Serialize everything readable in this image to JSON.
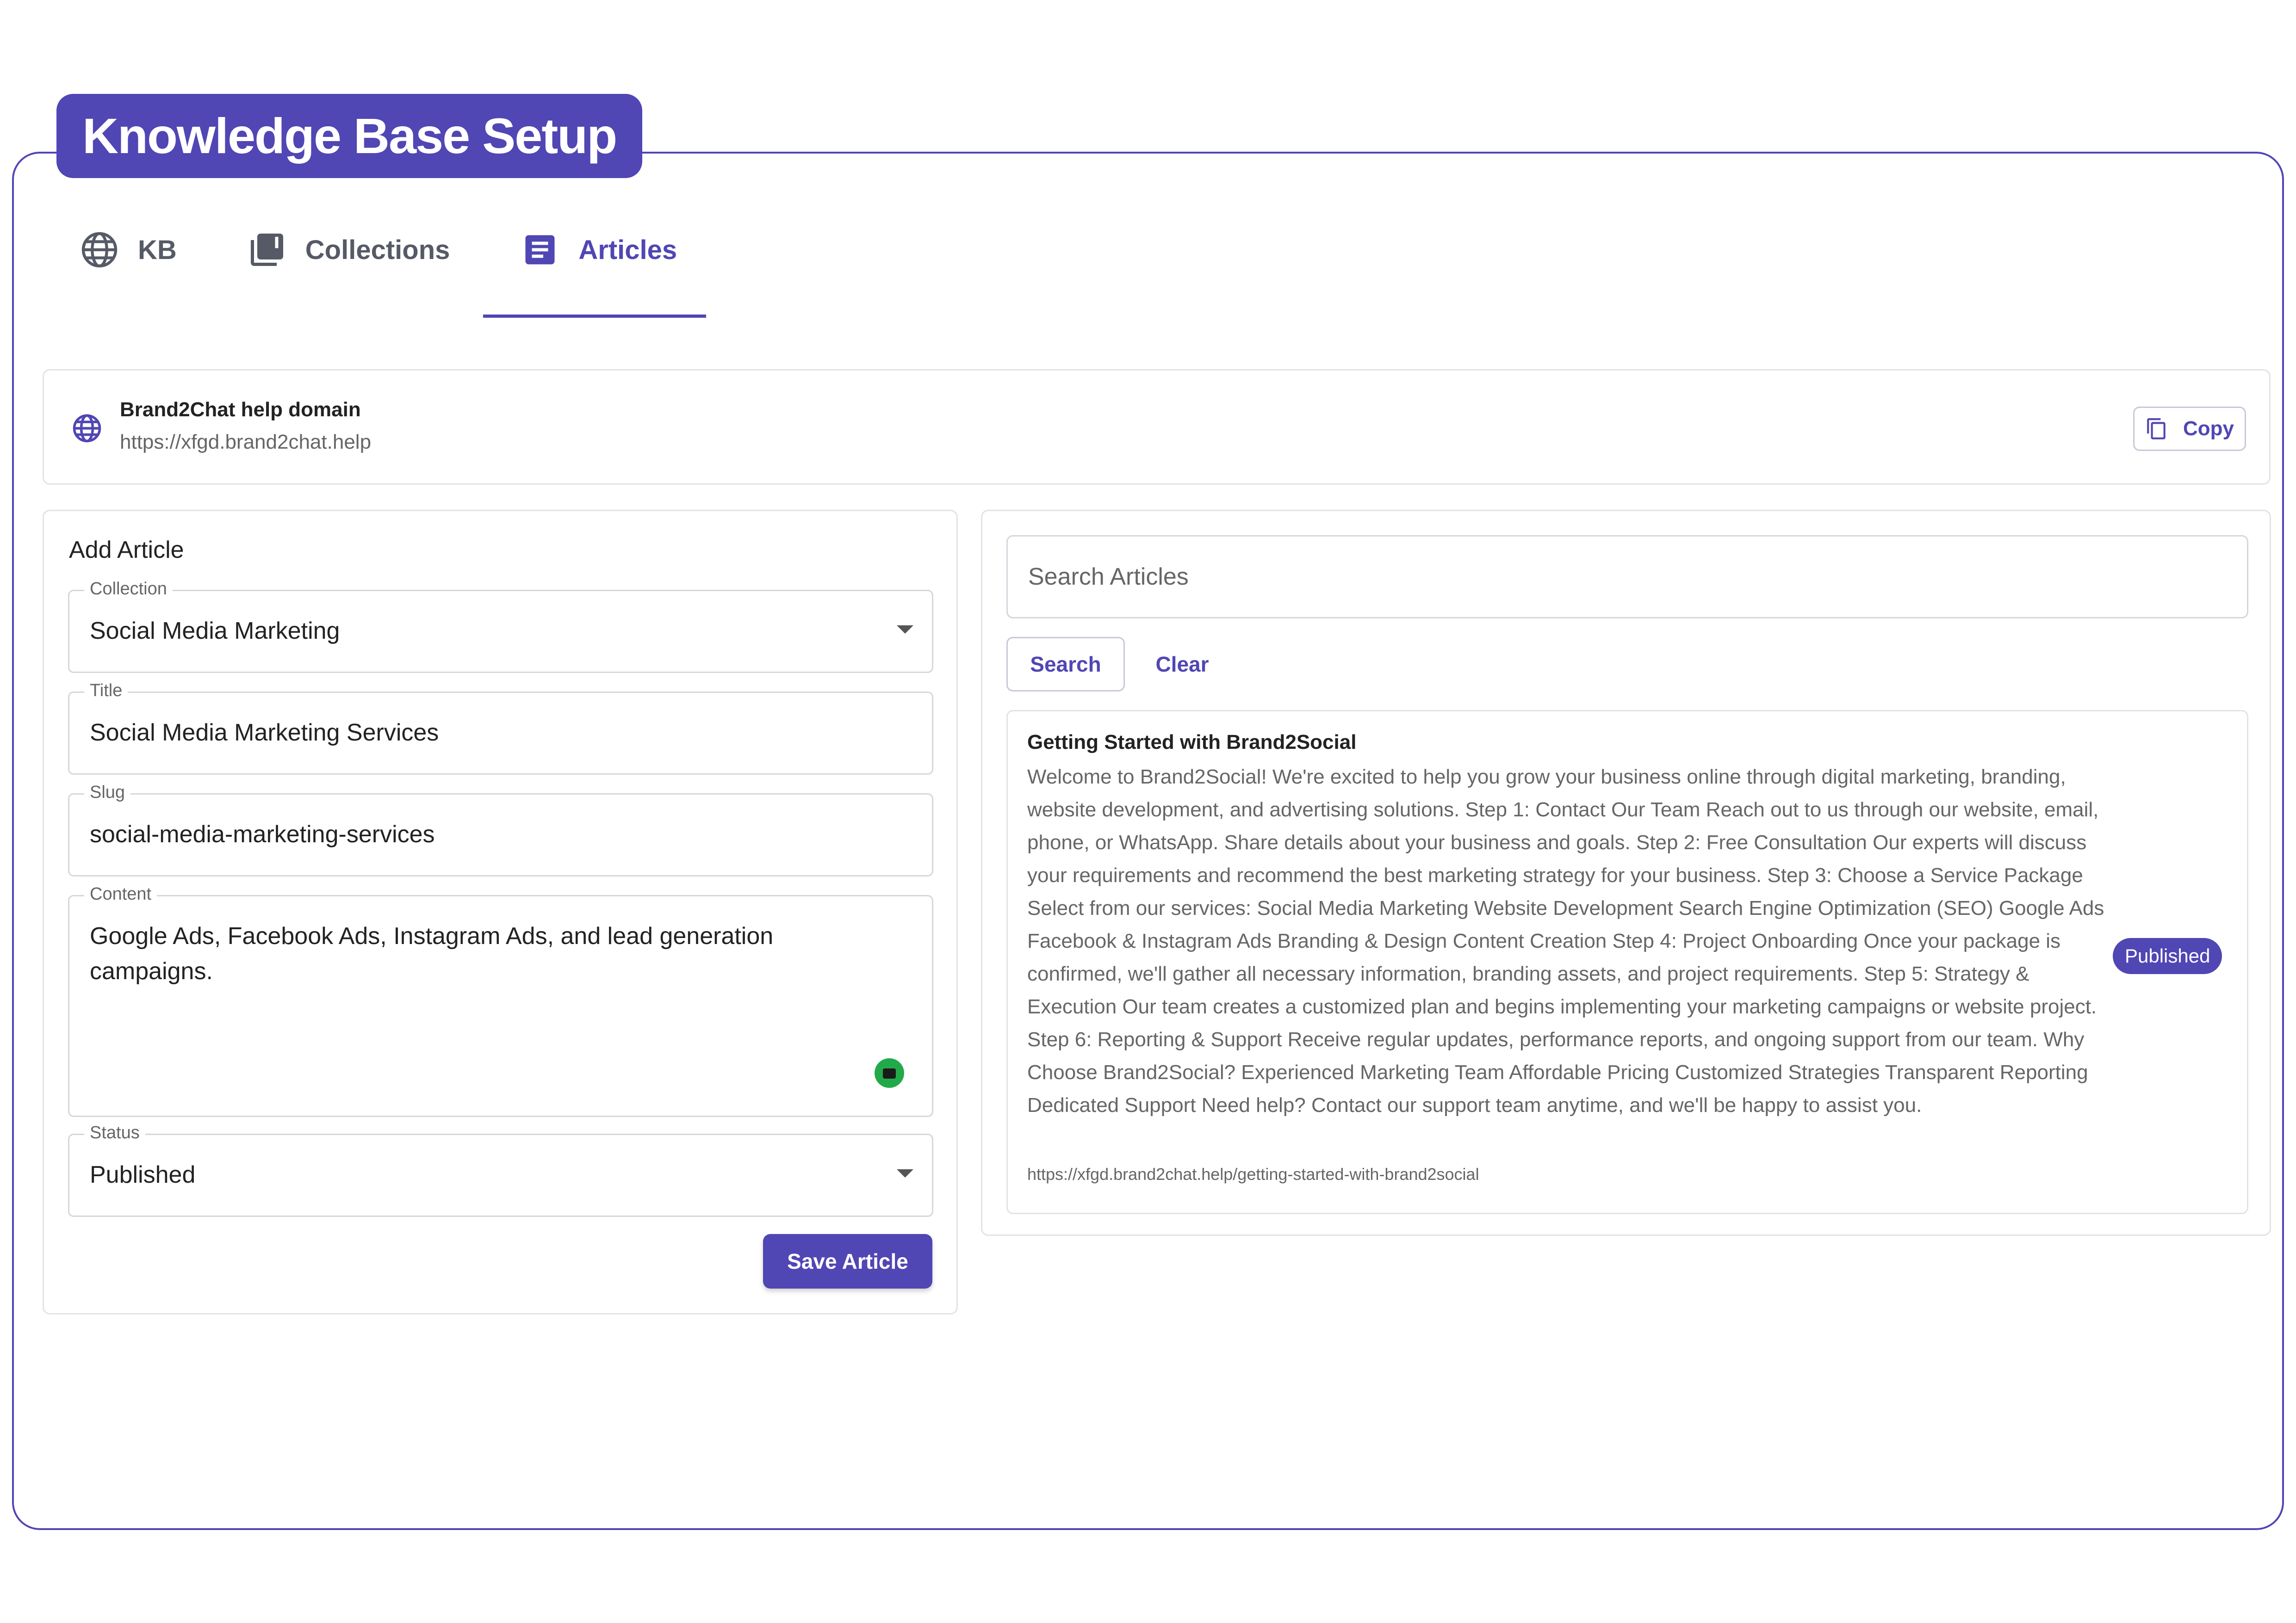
{
  "header": {
    "title": "Knowledge Base Setup"
  },
  "tabs": [
    {
      "label": "KB",
      "icon": "globe-icon",
      "active": false
    },
    {
      "label": "Collections",
      "icon": "library-icon",
      "active": false
    },
    {
      "label": "Articles",
      "icon": "article-icon",
      "active": true
    }
  ],
  "domain": {
    "label": "Brand2Chat help domain",
    "url": "https://xfgd.brand2chat.help",
    "copy_label": "Copy"
  },
  "add_article": {
    "heading": "Add Article",
    "collection": {
      "label": "Collection",
      "value": "Social Media Marketing"
    },
    "title": {
      "label": "Title",
      "value": "Social Media Marketing Services"
    },
    "slug": {
      "label": "Slug",
      "value": "social-media-marketing-services"
    },
    "content": {
      "label": "Content",
      "value": "Google Ads, Facebook Ads, Instagram Ads, and lead generation campaigns."
    },
    "status": {
      "label": "Status",
      "value": "Published"
    },
    "save_label": "Save Article"
  },
  "articles": {
    "search_placeholder": "Search Articles",
    "search_label": "Search",
    "clear_label": "Clear",
    "items": [
      {
        "title": "Getting Started with Brand2Social",
        "body": "Welcome to Brand2Social! We're excited to help you grow your business online through digital marketing, branding, website development, and advertising solutions. Step 1: Contact Our Team Reach out to us through our website, email, phone, or WhatsApp. Share details about your business and goals. Step 2: Free Consultation Our experts will discuss your requirements and recommend the best marketing strategy for your business. Step 3: Choose a Service Package Select from our services: Social Media Marketing Website Development Search Engine Optimization (SEO) Google Ads Facebook & Instagram Ads Branding & Design Content Creation Step 4: Project Onboarding Once your package is confirmed, we'll gather all necessary information, branding assets, and project requirements. Step 5: Strategy & Execution Our team creates a customized plan and begins implementing your marketing campaigns or website project. Step 6: Reporting & Support Receive regular updates, performance reports, and ongoing support from our team. Why Choose Brand2Social? Experienced Marketing Team Affordable Pricing Customized Strategies Transparent Reporting Dedicated Support Need help? Contact our support team anytime, and we'll be happy to assist you.",
        "url": "https://xfgd.brand2chat.help/getting-started-with-brand2social",
        "status": "Published"
      }
    ]
  },
  "colors": {
    "accent": "#5046b4",
    "border": "#e2e3e8",
    "robot": "#22aa4a"
  }
}
